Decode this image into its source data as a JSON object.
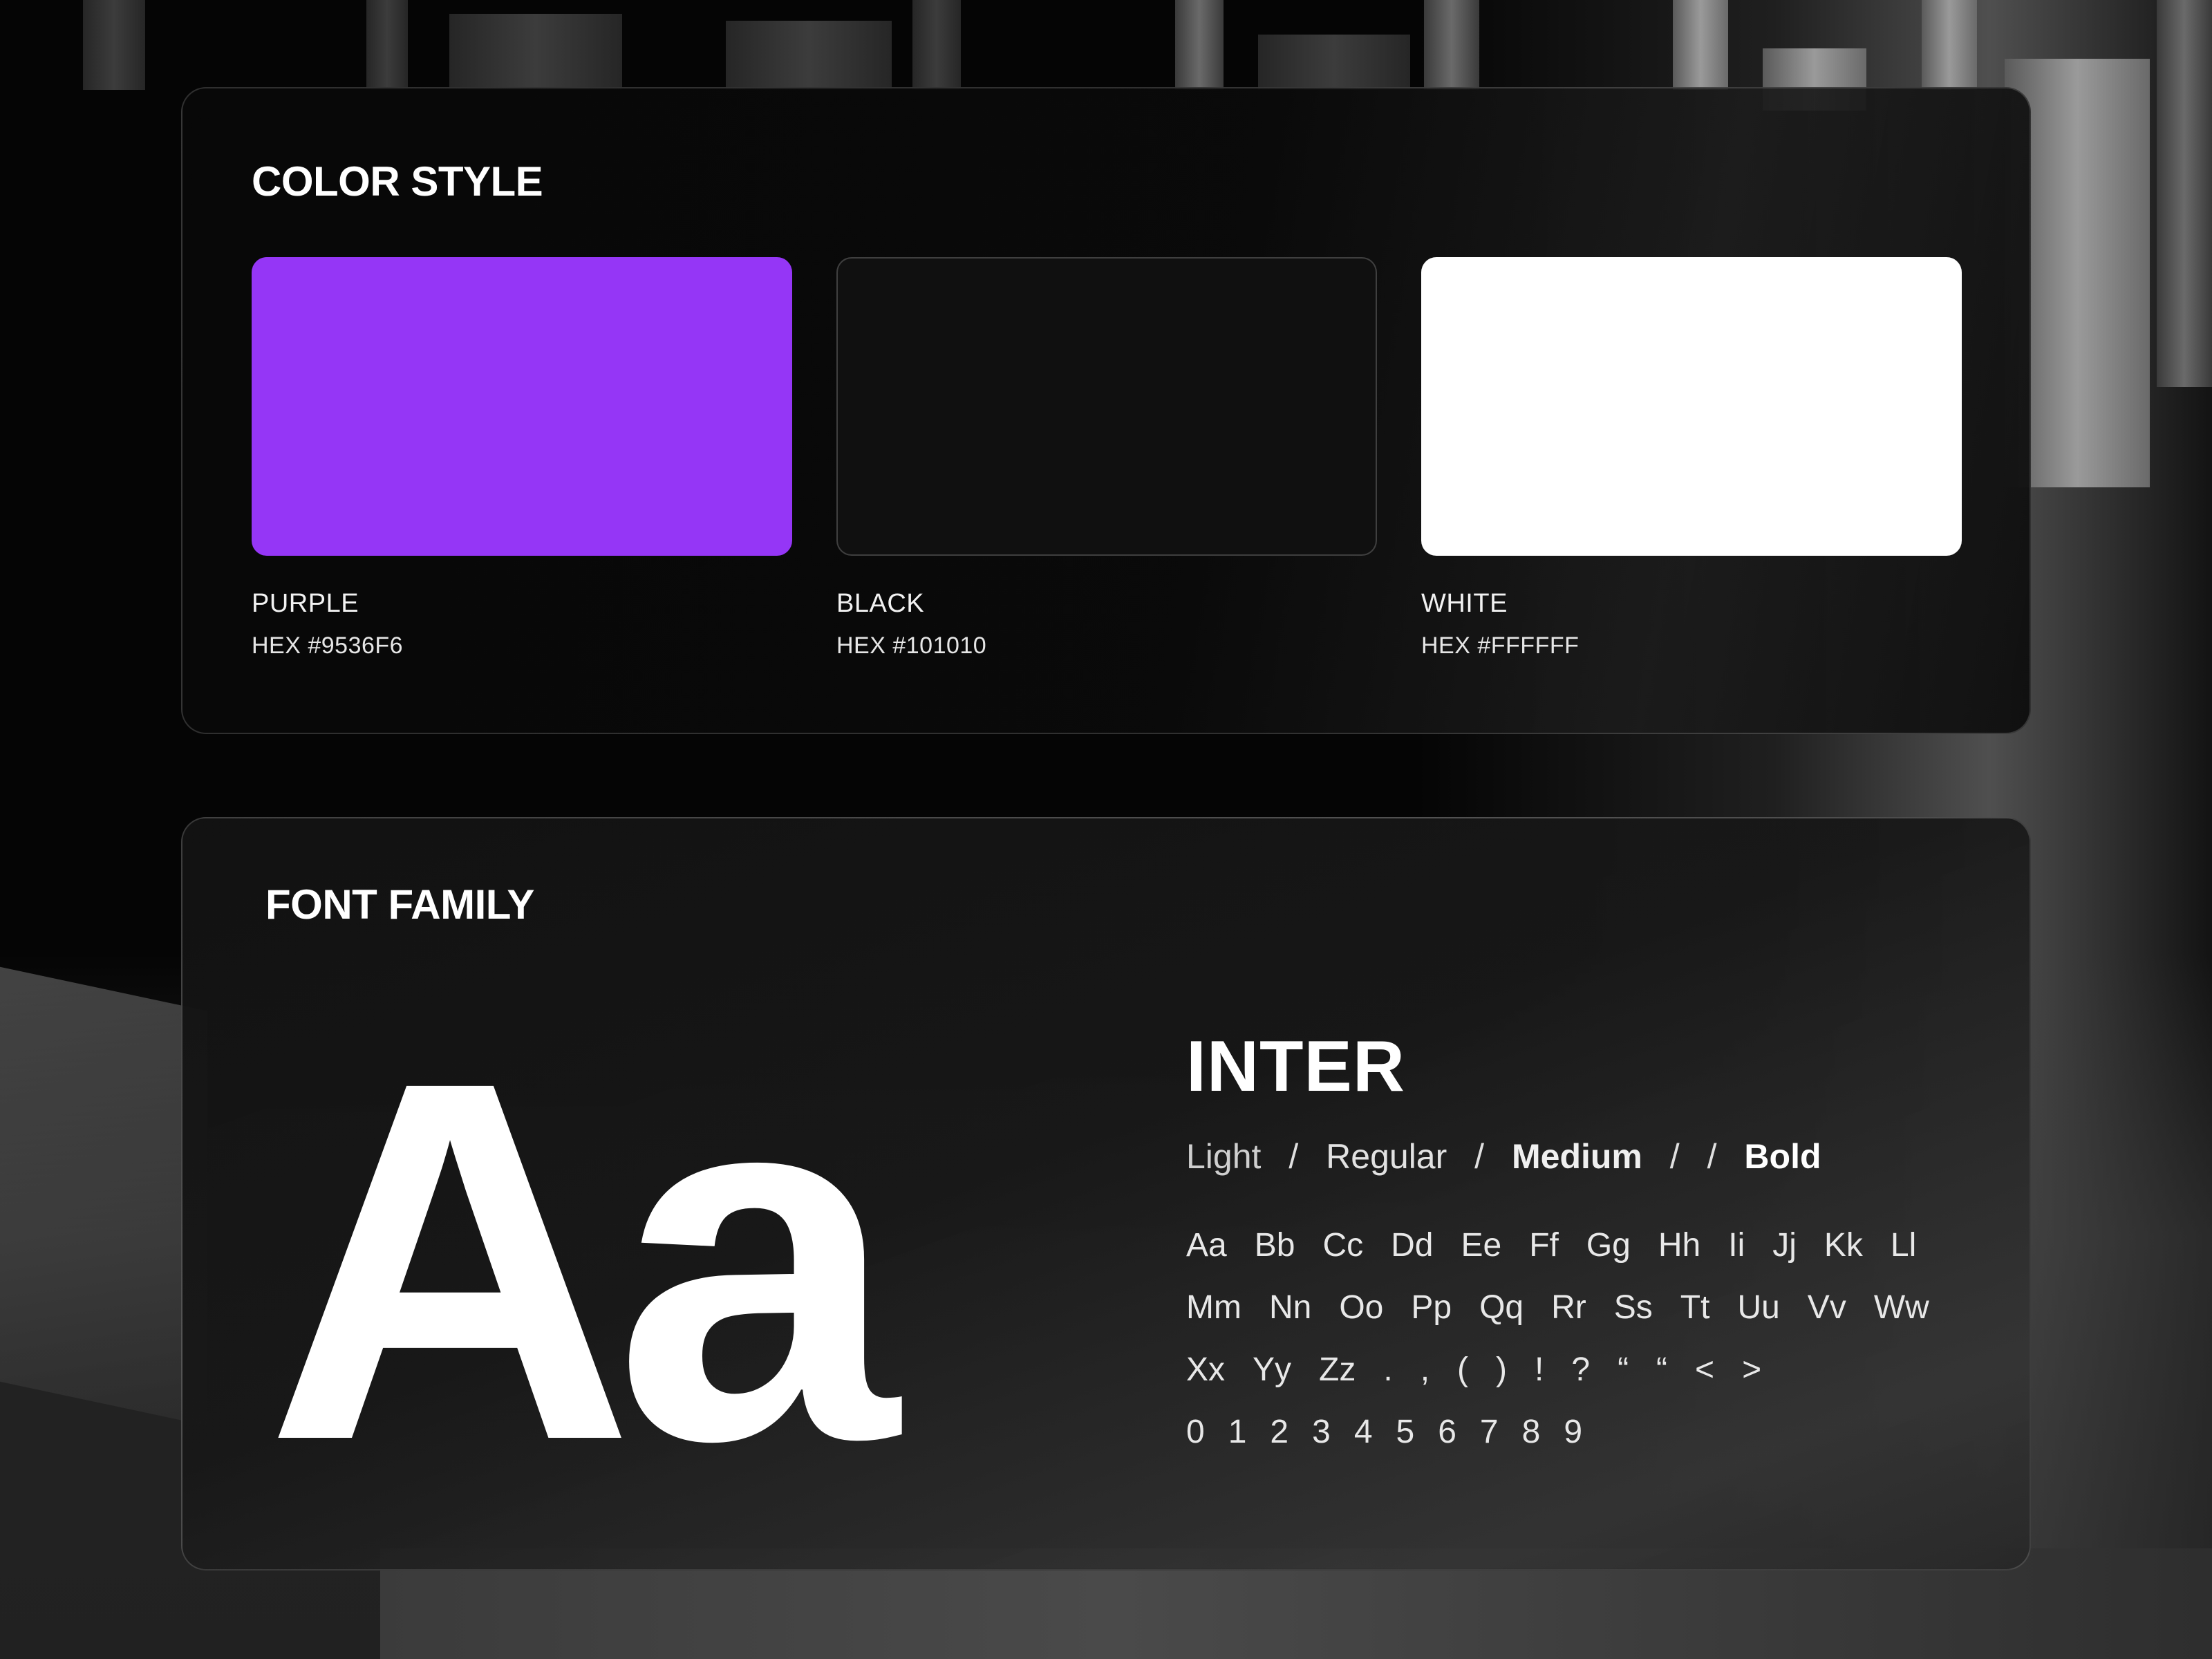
{
  "color_section": {
    "title": "COLOR STYLE",
    "swatches": [
      {
        "name": "PURPLE",
        "hex_label": "HEX #9536F6",
        "color": "#9536F6"
      },
      {
        "name": "BLACK",
        "hex_label": "HEX #101010",
        "color": "#101010"
      },
      {
        "name": "WHITE",
        "hex_label": "HEX #FFFFFF",
        "color": "#FFFFFF"
      }
    ]
  },
  "font_section": {
    "title": "FONT FAMILY",
    "specimen": "Aa",
    "font_name": "INTER",
    "weights": {
      "light": "Light",
      "sep1": "/",
      "regular": "Regular",
      "sep2": "/",
      "medium": "Medium",
      "sep3": "/",
      "sep4": "/",
      "bold": "Bold"
    },
    "glyph_rows": [
      [
        "Aa",
        "Bb",
        "Cc",
        "Dd",
        "Ee",
        "Ff",
        "Gg",
        "Hh",
        "Ii",
        "Jj",
        "Kk",
        "Ll"
      ],
      [
        "Mm",
        "Nn",
        "Oo",
        "Pp",
        "Qq",
        "Rr",
        "Ss",
        "Tt",
        "Uu",
        "Vv",
        "Ww"
      ],
      [
        "Xx",
        "Yy",
        "Zz",
        ".",
        ",",
        "(",
        ")",
        "!",
        "?",
        "“",
        "“",
        "<",
        ">"
      ],
      [
        "0",
        "1",
        "2",
        "3",
        "4",
        "5",
        "6",
        "7",
        "8",
        "9"
      ]
    ]
  }
}
